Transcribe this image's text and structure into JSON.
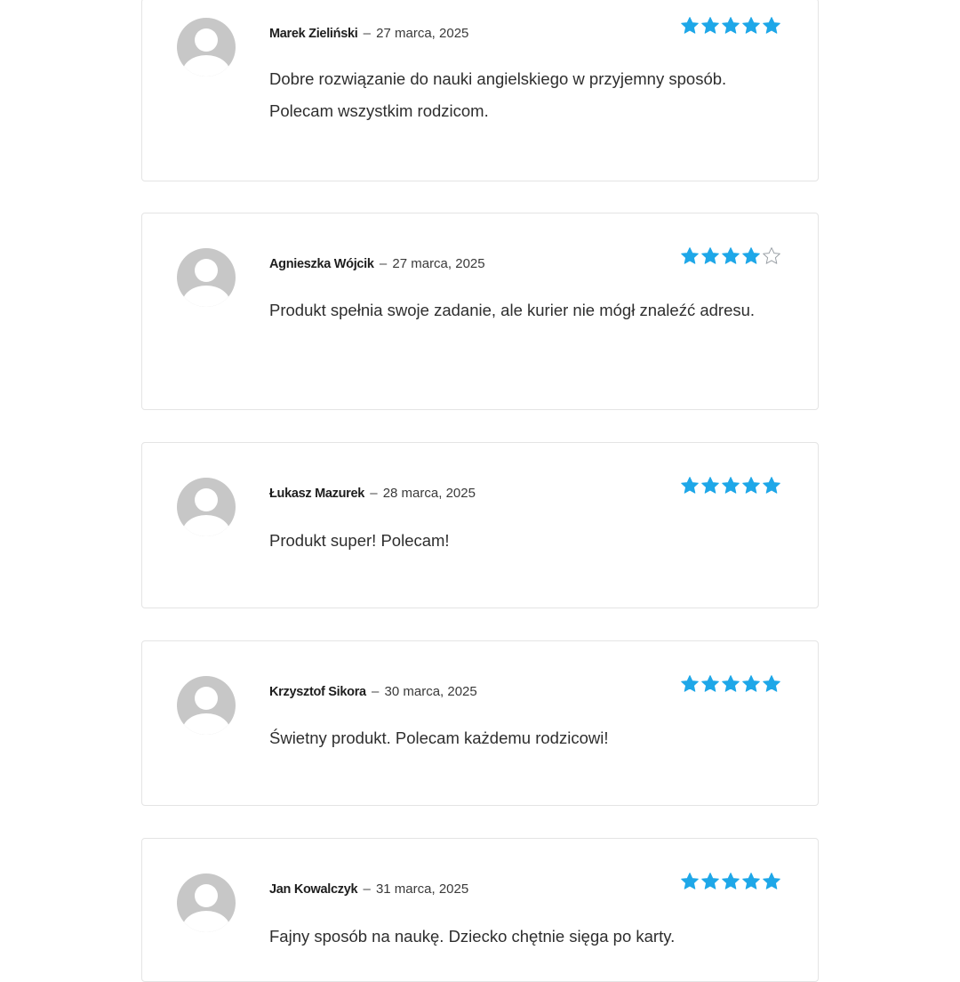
{
  "reviews": [
    {
      "author": "Marek Zieliński",
      "separator": "–",
      "date": "27 marca, 2025",
      "rating": 5,
      "max_rating": 5,
      "text": "Dobre rozwiązanie do nauki angielskiego w przyjemny sposób. Polecam wszystkim rodzicom."
    },
    {
      "author": "Agnieszka Wójcik",
      "separator": "–",
      "date": "27 marca, 2025",
      "rating": 4,
      "max_rating": 5,
      "text": "Produkt spełnia swoje zadanie, ale kurier nie mógł znaleźć adresu."
    },
    {
      "author": "Łukasz Mazurek",
      "separator": "–",
      "date": "28 marca, 2025",
      "rating": 5,
      "max_rating": 5,
      "text": "Produkt super! Polecam!"
    },
    {
      "author": "Krzysztof Sikora",
      "separator": "–",
      "date": "30 marca, 2025",
      "rating": 5,
      "max_rating": 5,
      "text": "Świetny produkt. Polecam każdemu rodzicowi!"
    },
    {
      "author": "Jan Kowalczyk",
      "separator": "–",
      "date": "31 marca, 2025",
      "rating": 5,
      "max_rating": 5,
      "text": "Fajny sposób na naukę. Dziecko chętnie sięga po karty."
    }
  ],
  "colors": {
    "star_filled": "#1ea7e8",
    "star_empty": "#9aa0a6",
    "avatar": "#c7c7c7",
    "card_border": "#e4e4e4"
  },
  "icons": {
    "avatar": "default-user-avatar-icon",
    "star_filled": "star-filled-icon",
    "star_empty": "star-outline-icon"
  }
}
